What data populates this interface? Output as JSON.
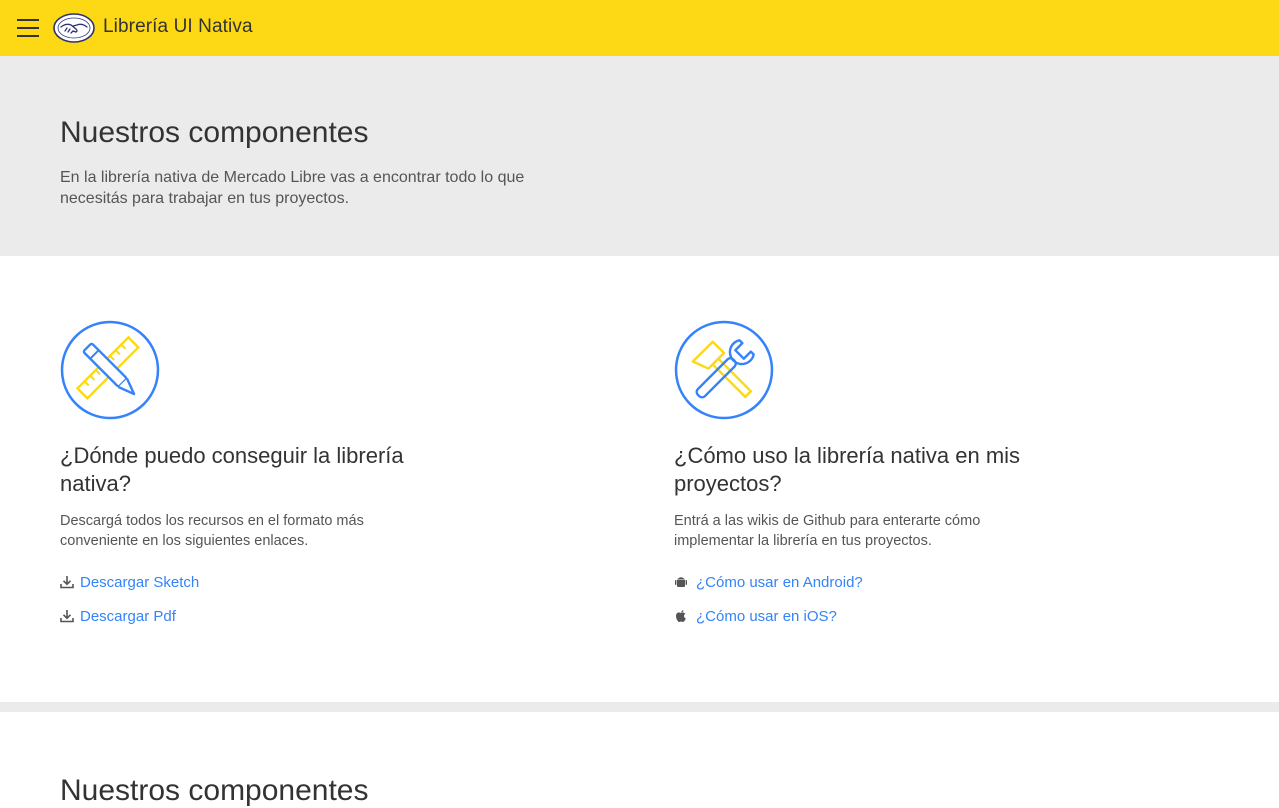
{
  "header": {
    "title": "Librería UI Nativa",
    "menu_icon": "hamburger-icon",
    "logo_icon": "handshake-logo",
    "background": "#fdd814"
  },
  "hero": {
    "title": "Nuestros componentes",
    "description": "En la librería nativa de Mercado Libre vas a encontrar todo lo que necesitás para trabajar en tus proyectos.",
    "background": "#ebebeb"
  },
  "cards": [
    {
      "icon": "pencil-ruler-icon",
      "title": "¿Dónde puedo conseguir la librería nativa?",
      "description": "Descargá todos los recursos en el formato más conveniente en los siguientes enlaces.",
      "links": [
        {
          "label": "Descargar Sketch",
          "icon": "download-icon"
        },
        {
          "label": "Descargar Pdf",
          "icon": "download-icon"
        }
      ]
    },
    {
      "icon": "hammer-wrench-icon",
      "title": "¿Cómo uso la librería nativa en mis proyectos?",
      "description": "Entrá a las wikis de Github para enterarte cómo implementar la librería en tus proyectos.",
      "links": [
        {
          "label": "¿Cómo usar en Android?",
          "icon": "android-icon"
        },
        {
          "label": "¿Cómo usar en iOS?",
          "icon": "apple-icon"
        }
      ]
    }
  ],
  "next_section": {
    "title": "Nuestros componentes"
  },
  "colors": {
    "link": "#3483fa",
    "icon_blue": "#3483fa",
    "icon_yellow": "#fdd814"
  }
}
